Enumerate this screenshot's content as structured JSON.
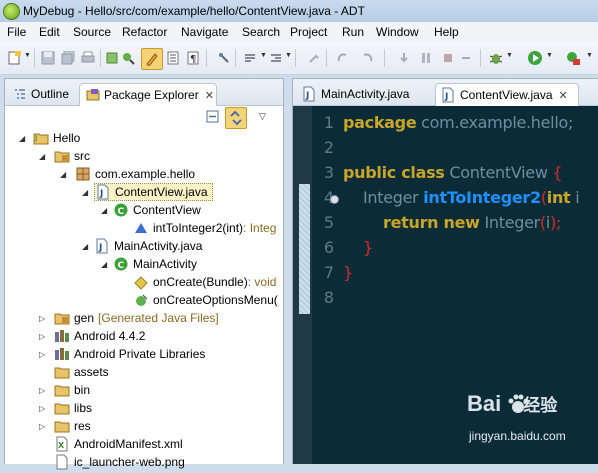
{
  "window": {
    "title": "MyDebug - Hello/src/com/example/hello/ContentView.java - ADT"
  },
  "menu": [
    "File",
    "Edit",
    "Source",
    "Refactor",
    "Navigate",
    "Search",
    "Project",
    "Run",
    "Window",
    "Help"
  ],
  "left_tabs": {
    "outline": "Outline",
    "package_explorer": "Package Explorer"
  },
  "tree": {
    "project": "Hello",
    "src": "src",
    "package": "com.example.hello",
    "file1": "ContentView.java",
    "class1": "ContentView",
    "method1": "intToInteger2(int)",
    "method1_type": " : Integ",
    "file2": "MainActivity.java",
    "class2": "MainActivity",
    "method2": "onCreate(Bundle)",
    "method2_type": " : void",
    "method3": "onCreateOptionsMenu(",
    "gen": "gen",
    "gen_note": "[Generated Java Files]",
    "android": "Android 4.4.2",
    "private_libs": "Android Private Libraries",
    "assets": "assets",
    "bin": "bin",
    "libs": "libs",
    "res": "res",
    "manifest": "AndroidManifest.xml",
    "last": "ic_launcher-web.png"
  },
  "editor_tabs": {
    "tab1": "MainActivity.java",
    "tab2": "ContentView.java"
  },
  "code": {
    "line_numbers": [
      "1",
      "2",
      "3",
      "4",
      "5",
      "6",
      "7",
      "8"
    ],
    "l1_kw": "package",
    "l1_rest": " com.example.hello;",
    "l3_kw": "public class",
    "l3_name": " ContentView ",
    "l3_br": " {",
    "l4_type": "Integer ",
    "l4_method": "intToInteger2",
    "l4_p1": "(",
    "l4_kw": "int",
    "l4_arg": " i",
    "l5_kw": "return new",
    "l5_type": " Integer",
    "l5_p1": "(",
    "l5_arg": "i",
    "l5_p2": ");",
    "l6": "}",
    "l7": "}"
  },
  "watermark": {
    "brand": "Bai",
    "brand2": "经验",
    "url": "jingyan.baidu.com"
  },
  "colors": {
    "editor_bg": "#0b2c37",
    "keyword": "#c9a528",
    "method": "#1e90ff",
    "brace": "#d42a2a"
  }
}
